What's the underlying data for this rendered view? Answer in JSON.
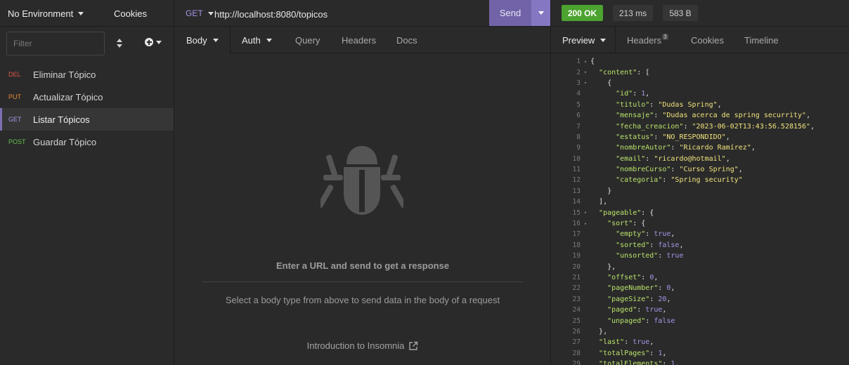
{
  "sidebar": {
    "environment": "No Environment",
    "cookies": "Cookies",
    "filter_placeholder": "Filter",
    "requests": [
      {
        "method": "DEL",
        "name": "Eliminar Tópico"
      },
      {
        "method": "PUT",
        "name": "Actualizar Tópico"
      },
      {
        "method": "GET",
        "name": "Listar Tópicos"
      },
      {
        "method": "POST",
        "name": "Guardar Tópico"
      }
    ]
  },
  "request": {
    "method": "GET",
    "url": "http://localhost:8080/topicos",
    "send_label": "Send",
    "tabs": {
      "body": "Body",
      "auth": "Auth",
      "query": "Query",
      "headers": "Headers",
      "docs": "Docs"
    },
    "empty_title": "Enter a URL and send to get a response",
    "empty_sub": "Select a body type from above to send data in the body of a request",
    "intro_link": "Introduction to Insomnia"
  },
  "response": {
    "status": "200 OK",
    "time": "213 ms",
    "size": "583 B",
    "tabs": {
      "preview": "Preview",
      "headers": "Headers",
      "headers_count": "3",
      "cookies": "Cookies",
      "timeline": "Timeline"
    },
    "lines": [
      {
        "n": "1",
        "fold": true,
        "indent": 0,
        "parts": [
          [
            "p",
            "{"
          ]
        ]
      },
      {
        "n": "2",
        "fold": true,
        "indent": 1,
        "parts": [
          [
            "k",
            "\"content\""
          ],
          [
            "p",
            ": ["
          ]
        ]
      },
      {
        "n": "3",
        "fold": true,
        "indent": 2,
        "parts": [
          [
            "p",
            "{"
          ]
        ]
      },
      {
        "n": "4",
        "fold": false,
        "indent": 3,
        "parts": [
          [
            "k",
            "\"id\""
          ],
          [
            "p",
            ": "
          ],
          [
            "n",
            "1"
          ],
          [
            "p",
            ","
          ]
        ]
      },
      {
        "n": "5",
        "fold": false,
        "indent": 3,
        "parts": [
          [
            "k",
            "\"titulo\""
          ],
          [
            "p",
            ": "
          ],
          [
            "s",
            "\"Dudas Spring\""
          ],
          [
            "p",
            ","
          ]
        ]
      },
      {
        "n": "6",
        "fold": false,
        "indent": 3,
        "parts": [
          [
            "k",
            "\"mensaje\""
          ],
          [
            "p",
            ": "
          ],
          [
            "s",
            "\"Dudas acerca de spring securrity\""
          ],
          [
            "p",
            ","
          ]
        ]
      },
      {
        "n": "7",
        "fold": false,
        "indent": 3,
        "parts": [
          [
            "k",
            "\"fecha_creacion\""
          ],
          [
            "p",
            ": "
          ],
          [
            "s",
            "\"2023-06-02T13:43:56.528156\""
          ],
          [
            "p",
            ","
          ]
        ]
      },
      {
        "n": "8",
        "fold": false,
        "indent": 3,
        "parts": [
          [
            "k",
            "\"estatus\""
          ],
          [
            "p",
            ": "
          ],
          [
            "s",
            "\"NO_RESPONDIDO\""
          ],
          [
            "p",
            ","
          ]
        ]
      },
      {
        "n": "9",
        "fold": false,
        "indent": 3,
        "parts": [
          [
            "k",
            "\"nombreAutor\""
          ],
          [
            "p",
            ": "
          ],
          [
            "s",
            "\"Ricardo Ramírez\""
          ],
          [
            "p",
            ","
          ]
        ]
      },
      {
        "n": "10",
        "fold": false,
        "indent": 3,
        "parts": [
          [
            "k",
            "\"email\""
          ],
          [
            "p",
            ": "
          ],
          [
            "s",
            "\"ricardo@hotmail\""
          ],
          [
            "p",
            ","
          ]
        ]
      },
      {
        "n": "11",
        "fold": false,
        "indent": 3,
        "parts": [
          [
            "k",
            "\"nombreCurso\""
          ],
          [
            "p",
            ": "
          ],
          [
            "s",
            "\"Curso Spring\""
          ],
          [
            "p",
            ","
          ]
        ]
      },
      {
        "n": "12",
        "fold": false,
        "indent": 3,
        "parts": [
          [
            "k",
            "\"categoria\""
          ],
          [
            "p",
            ": "
          ],
          [
            "s",
            "\"Spring security\""
          ]
        ]
      },
      {
        "n": "13",
        "fold": false,
        "indent": 2,
        "parts": [
          [
            "p",
            "}"
          ]
        ]
      },
      {
        "n": "14",
        "fold": false,
        "indent": 1,
        "parts": [
          [
            "p",
            "],"
          ]
        ]
      },
      {
        "n": "15",
        "fold": true,
        "indent": 1,
        "parts": [
          [
            "k",
            "\"pageable\""
          ],
          [
            "p",
            ": {"
          ]
        ]
      },
      {
        "n": "16",
        "fold": true,
        "indent": 2,
        "parts": [
          [
            "k",
            "\"sort\""
          ],
          [
            "p",
            ": {"
          ]
        ]
      },
      {
        "n": "17",
        "fold": false,
        "indent": 3,
        "parts": [
          [
            "k",
            "\"empty\""
          ],
          [
            "p",
            ": "
          ],
          [
            "b",
            "true"
          ],
          [
            "p",
            ","
          ]
        ]
      },
      {
        "n": "18",
        "fold": false,
        "indent": 3,
        "parts": [
          [
            "k",
            "\"sorted\""
          ],
          [
            "p",
            ": "
          ],
          [
            "b",
            "false"
          ],
          [
            "p",
            ","
          ]
        ]
      },
      {
        "n": "19",
        "fold": false,
        "indent": 3,
        "parts": [
          [
            "k",
            "\"unsorted\""
          ],
          [
            "p",
            ": "
          ],
          [
            "b",
            "true"
          ]
        ]
      },
      {
        "n": "20",
        "fold": false,
        "indent": 2,
        "parts": [
          [
            "p",
            "},"
          ]
        ]
      },
      {
        "n": "21",
        "fold": false,
        "indent": 2,
        "parts": [
          [
            "k",
            "\"offset\""
          ],
          [
            "p",
            ": "
          ],
          [
            "n",
            "0"
          ],
          [
            "p",
            ","
          ]
        ]
      },
      {
        "n": "22",
        "fold": false,
        "indent": 2,
        "parts": [
          [
            "k",
            "\"pageNumber\""
          ],
          [
            "p",
            ": "
          ],
          [
            "n",
            "0"
          ],
          [
            "p",
            ","
          ]
        ]
      },
      {
        "n": "23",
        "fold": false,
        "indent": 2,
        "parts": [
          [
            "k",
            "\"pageSize\""
          ],
          [
            "p",
            ": "
          ],
          [
            "n",
            "20"
          ],
          [
            "p",
            ","
          ]
        ]
      },
      {
        "n": "24",
        "fold": false,
        "indent": 2,
        "parts": [
          [
            "k",
            "\"paged\""
          ],
          [
            "p",
            ": "
          ],
          [
            "b",
            "true"
          ],
          [
            "p",
            ","
          ]
        ]
      },
      {
        "n": "25",
        "fold": false,
        "indent": 2,
        "parts": [
          [
            "k",
            "\"unpaged\""
          ],
          [
            "p",
            ": "
          ],
          [
            "b",
            "false"
          ]
        ]
      },
      {
        "n": "26",
        "fold": false,
        "indent": 1,
        "parts": [
          [
            "p",
            "},"
          ]
        ]
      },
      {
        "n": "27",
        "fold": false,
        "indent": 1,
        "parts": [
          [
            "k",
            "\"last\""
          ],
          [
            "p",
            ": "
          ],
          [
            "b",
            "true"
          ],
          [
            "p",
            ","
          ]
        ]
      },
      {
        "n": "28",
        "fold": false,
        "indent": 1,
        "parts": [
          [
            "k",
            "\"totalPages\""
          ],
          [
            "p",
            ": "
          ],
          [
            "n",
            "1"
          ],
          [
            "p",
            ","
          ]
        ]
      },
      {
        "n": "29",
        "fold": false,
        "indent": 1,
        "parts": [
          [
            "k",
            "\"totalElements\""
          ],
          [
            "p",
            ": "
          ],
          [
            "n",
            "1"
          ],
          [
            "p",
            ","
          ]
        ]
      }
    ]
  }
}
